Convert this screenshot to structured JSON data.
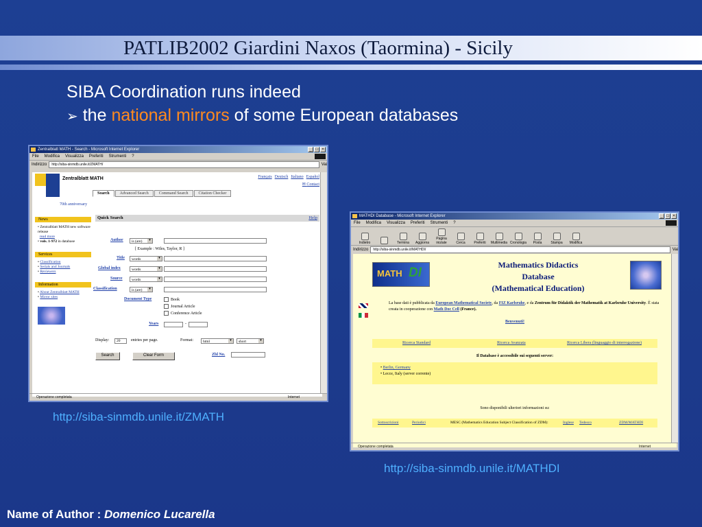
{
  "slide": {
    "title": "PATLIB2002 Giardini Naxos (Taormina) - Sicily",
    "line1": "SIBA Coordination runs indeed",
    "line2_arrow": "➢",
    "line2_pre": "the",
    "line2_accent": "national mirrors",
    "line2_post": "of some European databases",
    "url_zmath": "http://siba-sinmdb.unile.it/ZMATH",
    "url_mathdi": "http://siba-sinmdb.unile.it/MATHDI",
    "author_label": "Name of Author :",
    "author_name": "Domenico Lucarella",
    "colors": {
      "background": "#1c3b8c",
      "accent": "#ff8a1f",
      "link": "#4fb0ff"
    }
  },
  "zmath": {
    "window_title": "Zentralblatt MATH - Search - Microsoft Internet Explorer",
    "menu": [
      "File",
      "Modifica",
      "Visualizza",
      "Preferiti",
      "Strumenti",
      "?"
    ],
    "address_label": "Indirizzo",
    "address": "http://siba-sinmdb.unile.it/ZMATH/",
    "go": "Vai",
    "brand": "Zentralblatt MATH",
    "langs": [
      "Français",
      "Deutsch",
      "Italiano",
      "Español"
    ],
    "contact": "Contact",
    "tabs": [
      "Search",
      "Advanced Search",
      "Command Search",
      "Citation Checker"
    ],
    "anniversary": "70th anniversary",
    "news_head": "News",
    "news_1": "Zentralblatt MATH new software release",
    "news_more": "read more",
    "news_2_bold": "vols. 1-972",
    "news_2": "in database",
    "services_head": "Services",
    "services": [
      "Classification",
      "Serials and Journals",
      "Reviewers"
    ],
    "info_head": "Information",
    "info": [
      "About Zentralblatt MATH",
      "Mirror sites"
    ],
    "quick_search": "Quick Search",
    "help": "Help",
    "author_label": "Author",
    "author_sel": "is (are)",
    "example": "[ Example : Wiles, Taylor, R ]",
    "title_label": "Title",
    "title_sel": "words",
    "global_label": "Global index",
    "global_sel": "words",
    "source_label": "Source",
    "source_sel": "words",
    "class_label": "Classification",
    "class_sel": "is (are)",
    "doctype_label": "Document Type",
    "doctypes": [
      "Book",
      "Journal Article",
      "Conference Article"
    ],
    "years_label": "Years",
    "years_dash": "-",
    "display_label": "Display:",
    "display_value": "20",
    "entries_label": "entries per page.",
    "format_label": "Format:",
    "format_value": "html",
    "format2_value": "short",
    "search_btn": "Search",
    "clear_btn": "Clear Form",
    "zbl_label": "Zbl No.",
    "status": "Operazione completata",
    "zone": "Internet"
  },
  "mathdi": {
    "window_title": "MATHDI Database - Microsoft Internet Explorer",
    "menu": [
      "File",
      "Modifica",
      "Visualizza",
      "Preferiti",
      "Strumenti",
      "?"
    ],
    "toolbar": [
      "Indietro",
      "",
      "Termina",
      "Aggiorna",
      "Pagina iniziale",
      "Cerca",
      "Preferiti",
      "Multimedia",
      "Cronologia",
      "Posta",
      "Stampa",
      "Modifica"
    ],
    "address_label": "Indirizzo",
    "address": "http://siba-sinmdb.unile.it/MATHDI/",
    "go": "Vai",
    "logo_math": "MATH",
    "logo_di": "DI",
    "title_1": "Mathematics Didactics",
    "title_2": "Database",
    "title_3": "(Mathematical Education)",
    "text_1": "La base dati è pubblicata da",
    "ems": "European Mathematical Society",
    "text_2": ", da",
    "fiz": "FIZ Karlsruhe",
    "text_3": ", e da",
    "zentrum": "Zentrum für Didaktik der Mathematik at Karlsruhe University",
    "text_4": ". È stata creata in cooperazione con",
    "mdc": "Math Doc Cell",
    "text_5": "(France).",
    "benvenuti": "Benvenuti!",
    "search_links": [
      "Ricerca Standard",
      "Ricerca Avanzata",
      "Ricerca Libera (linguaggio di interrogazione)"
    ],
    "servers_head": "Il Database è accessibile sui seguenti server:",
    "server_1": "Berlin, Germany",
    "server_2": "Lecce, Italy (server corrente)",
    "more_info": "Sono disponibili ulteriori informazioni su:",
    "bottom_links": [
      "Sottoscrizioni",
      "Periodici"
    ],
    "mesc": "MESC (Mathematics Education Subject Classification of ZDM):",
    "inglese": "Inglese",
    "tedesco": "Tedesco",
    "zdm": "ZDM/MATHDI",
    "status": "Operazione completata",
    "zone": "Internet"
  }
}
